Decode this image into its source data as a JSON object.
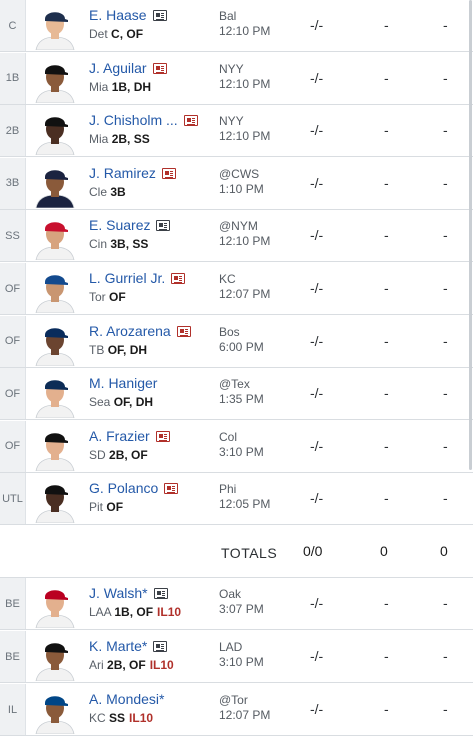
{
  "players": [
    {
      "slot": "C",
      "name": "E. Haase",
      "news": "plain",
      "team": "Det",
      "pos": "C, OF",
      "inj": "",
      "opp": "Bal",
      "time": "12:10 PM",
      "stat1": "-/-",
      "stat2": "-",
      "stat3": "-",
      "cap": "#1e2f4d",
      "skin": "#e7b995",
      "jersey": "#f2f2f2"
    },
    {
      "slot": "1B",
      "name": "J. Aguilar",
      "news": "hot",
      "team": "Mia",
      "pos": "1B, DH",
      "inj": "",
      "opp": "NYY",
      "time": "12:10 PM",
      "stat1": "-/-",
      "stat2": "-",
      "stat3": "-",
      "cap": "#111111",
      "skin": "#8a5a3a",
      "jersey": "#f2f2f2"
    },
    {
      "slot": "2B",
      "name": "J. Chisholm ...",
      "news": "hot",
      "team": "Mia",
      "pos": "2B, SS",
      "inj": "",
      "opp": "NYY",
      "time": "12:10 PM",
      "stat1": "-/-",
      "stat2": "-",
      "stat3": "-",
      "cap": "#111111",
      "skin": "#4a2e22",
      "jersey": "#f2f2f2"
    },
    {
      "slot": "3B",
      "name": "J. Ramirez",
      "news": "hot",
      "team": "Cle",
      "pos": "3B",
      "inj": "",
      "opp": "@CWS",
      "time": "1:10 PM",
      "stat1": "-/-",
      "stat2": "-",
      "stat3": "-",
      "cap": "#1b2340",
      "skin": "#8a5a3a",
      "jersey": "#1b2340"
    },
    {
      "slot": "SS",
      "name": "E. Suarez",
      "news": "plain",
      "team": "Cin",
      "pos": "3B, SS",
      "inj": "",
      "opp": "@NYM",
      "time": "12:10 PM",
      "stat1": "-/-",
      "stat2": "-",
      "stat3": "-",
      "cap": "#c8102e",
      "skin": "#d7a37e",
      "jersey": "#f2f2f2"
    },
    {
      "slot": "OF",
      "name": "L. Gurriel Jr.",
      "news": "hot",
      "team": "Tor",
      "pos": "OF",
      "inj": "",
      "opp": "KC",
      "time": "12:07 PM",
      "stat1": "-/-",
      "stat2": "-",
      "stat3": "-",
      "cap": "#134a8e",
      "skin": "#c99671",
      "jersey": "#f2f2f2"
    },
    {
      "slot": "OF",
      "name": "R. Arozarena",
      "news": "hot",
      "team": "TB",
      "pos": "OF, DH",
      "inj": "",
      "opp": "Bos",
      "time": "6:00 PM",
      "stat1": "-/-",
      "stat2": "-",
      "stat3": "-",
      "cap": "#092c5c",
      "skin": "#6b4430",
      "jersey": "#f2f2f2"
    },
    {
      "slot": "OF",
      "name": "M. Haniger",
      "news": "none",
      "team": "Sea",
      "pos": "OF, DH",
      "inj": "",
      "opp": "@Tex",
      "time": "1:35 PM",
      "stat1": "-/-",
      "stat2": "-",
      "stat3": "-",
      "cap": "#0c2c56",
      "skin": "#e3b08e",
      "jersey": "#f2f2f2"
    },
    {
      "slot": "OF",
      "name": "A. Frazier",
      "news": "hot",
      "team": "SD",
      "pos": "2B, OF",
      "inj": "",
      "opp": "Col",
      "time": "3:10 PM",
      "stat1": "-/-",
      "stat2": "-",
      "stat3": "-",
      "cap": "#111111",
      "skin": "#e3b08e",
      "jersey": "#f2f2f2"
    },
    {
      "slot": "UTL",
      "name": "G. Polanco",
      "news": "hot",
      "team": "Pit",
      "pos": "OF",
      "inj": "",
      "opp": "Phi",
      "time": "12:05 PM",
      "stat1": "-/-",
      "stat2": "-",
      "stat3": "-",
      "cap": "#111111",
      "skin": "#4a2e22",
      "jersey": "#f2f2f2"
    }
  ],
  "totals": {
    "label": "TOTALS",
    "v1": "0/0",
    "v2": "0",
    "v3": "0"
  },
  "bench": [
    {
      "slot": "BE",
      "name": "J. Walsh*",
      "news": "plain",
      "team": "LAA",
      "pos": "1B, OF",
      "inj": "IL10",
      "opp": "Oak",
      "time": "3:07 PM",
      "stat1": "-/-",
      "stat2": "-",
      "stat3": "-",
      "cap": "#ba0021",
      "skin": "#e3b08e",
      "jersey": "#f2f2f2"
    },
    {
      "slot": "BE",
      "name": "K. Marte*",
      "news": "plain",
      "team": "Ari",
      "pos": "2B, OF",
      "inj": "IL10",
      "opp": "LAD",
      "time": "3:10 PM",
      "stat1": "-/-",
      "stat2": "-",
      "stat3": "-",
      "cap": "#111111",
      "skin": "#8a5a3a",
      "jersey": "#f2f2f2"
    },
    {
      "slot": "IL",
      "name": "A. Mondesi*",
      "news": "none",
      "team": "KC",
      "pos": "SS",
      "inj": "IL10",
      "opp": "@Tor",
      "time": "12:07 PM",
      "stat1": "-/-",
      "stat2": "-",
      "stat3": "-",
      "cap": "#004687",
      "skin": "#8a5a3a",
      "jersey": "#f2f2f2"
    }
  ]
}
